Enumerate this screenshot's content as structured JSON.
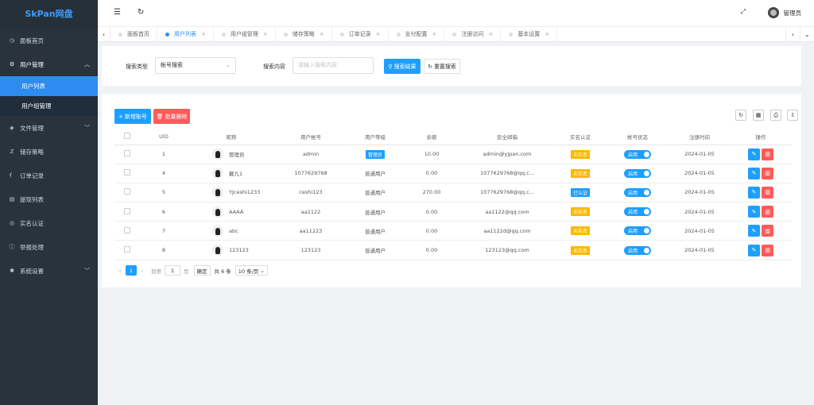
{
  "app": {
    "title": "SkPan网盘"
  },
  "sidebar": {
    "items": [
      {
        "label": "面板首页",
        "icon": "dashboard-icon"
      },
      {
        "label": "用户管理",
        "icon": "gear-icon"
      },
      {
        "label": "文件管理",
        "icon": "layers-icon"
      },
      {
        "label": "储存策略",
        "icon": "policy-icon"
      },
      {
        "label": "订单记录",
        "icon": "chart-icon"
      },
      {
        "label": "提现列表",
        "icon": "list-icon"
      },
      {
        "label": "实名认证",
        "icon": "shield-icon"
      },
      {
        "label": "举报处理",
        "icon": "info-icon"
      },
      {
        "label": "系统设置",
        "icon": "gear-icon"
      }
    ],
    "subitems": [
      {
        "label": "用户列表",
        "active": true
      },
      {
        "label": "用户组管理",
        "active": false
      }
    ]
  },
  "header": {
    "user_name": "管理员"
  },
  "tabs": [
    {
      "label": "面板首页",
      "active": false,
      "closable": false
    },
    {
      "label": "用户列表",
      "active": true,
      "closable": true
    },
    {
      "label": "用户组管理",
      "active": false,
      "closable": true
    },
    {
      "label": "储存策略",
      "active": false,
      "closable": true
    },
    {
      "label": "订单记录",
      "active": false,
      "closable": true
    },
    {
      "label": "支付配置",
      "active": false,
      "closable": true
    },
    {
      "label": "注册访问",
      "active": false,
      "closable": true
    },
    {
      "label": "基本设置",
      "active": false,
      "closable": true
    }
  ],
  "search": {
    "type_label": "搜索类型",
    "type_value": "帐号搜索",
    "content_label": "搜索内容",
    "content_placeholder": "请输入搜索内容",
    "search_button": "搜索结果",
    "reset_button": "重置搜索"
  },
  "toolbar": {
    "add_label": "新增账号",
    "batch_delete_label": "批量删除"
  },
  "table": {
    "columns": [
      "UID",
      "昵称",
      "用户帐号",
      "用户等级",
      "余额",
      "安全邮箱",
      "实名认证",
      "帐号状态",
      "注册时间",
      "操作"
    ],
    "rows": [
      {
        "uid": "1",
        "nickname": "管理员",
        "account": "admin",
        "level": "管理员",
        "level_badge": true,
        "balance": "10.00",
        "email": "admin@yjpan.com",
        "realname": "未实名",
        "realname_color": "#ffb800",
        "status": "启用",
        "reg_time": "2024-01-05"
      },
      {
        "uid": "4",
        "nickname": "戴九1",
        "account": "1077629768",
        "level": "普通用户",
        "level_badge": false,
        "balance": "0.00",
        "email": "1077629768@qq.c...",
        "realname": "未实名",
        "realname_color": "#ffb800",
        "status": "启用",
        "reg_time": "2024-01-05"
      },
      {
        "uid": "5",
        "nickname": "YJceshi1233",
        "account": "ceshi123",
        "level": "普通用户",
        "level_badge": false,
        "balance": "270.00",
        "email": "1077629768@qq.c...",
        "realname": "已认证",
        "realname_color": "#1e9fff",
        "status": "启用",
        "reg_time": "2024-01-05"
      },
      {
        "uid": "6",
        "nickname": "AAAA",
        "account": "aa1122",
        "level": "普通用户",
        "level_badge": false,
        "balance": "0.00",
        "email": "aa1122@qq.com",
        "realname": "未实名",
        "realname_color": "#ffb800",
        "status": "启用",
        "reg_time": "2024-01-05"
      },
      {
        "uid": "7",
        "nickname": "abc",
        "account": "aa11223",
        "level": "普通用户",
        "level_badge": false,
        "balance": "0.00",
        "email": "aa1122d@qq.com",
        "realname": "未实名",
        "realname_color": "#ffb800",
        "status": "启用",
        "reg_time": "2024-01-05"
      },
      {
        "uid": "8",
        "nickname": "123123",
        "account": "123123",
        "level": "普通用户",
        "level_badge": false,
        "balance": "0.00",
        "email": "123123@qq.com",
        "realname": "未实名",
        "realname_color": "#ffb800",
        "status": "启用",
        "reg_time": "2024-01-05"
      }
    ]
  },
  "pagination": {
    "current_page": "1",
    "goto_label": "到第",
    "goto_value": "1",
    "page_unit": "页",
    "confirm_label": "确定",
    "total_label": "共 6 条",
    "page_size_label": "10 条/页"
  },
  "colors": {
    "primary": "#1e9fff",
    "danger": "#ff5b5b",
    "warning": "#ffb800",
    "sidebar_bg": "#28333e",
    "active_menu": "#2d8cf0"
  }
}
